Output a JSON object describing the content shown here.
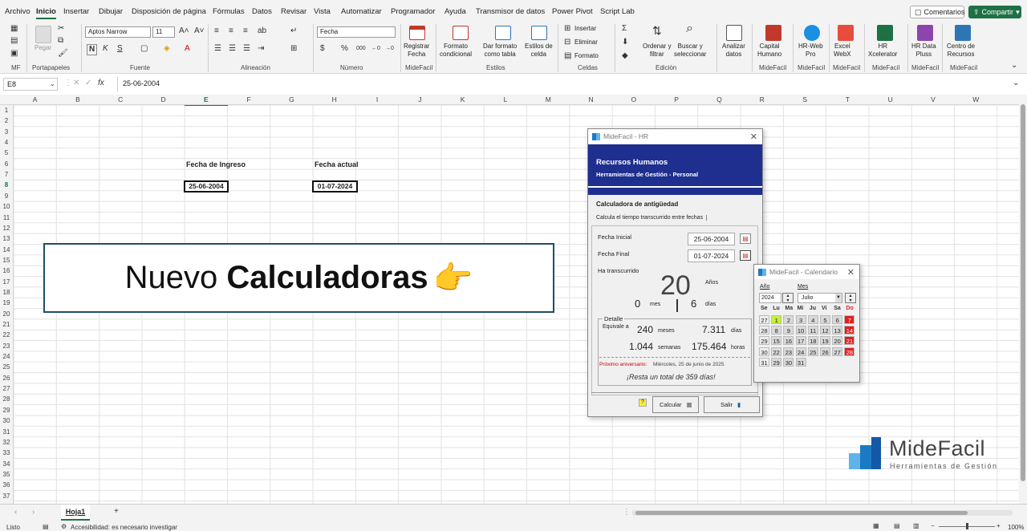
{
  "menu": {
    "tabs": [
      "Archivo",
      "Inicio",
      "Insertar",
      "Dibujar",
      "Disposición de página",
      "Fórmulas",
      "Datos",
      "Revisar",
      "Vista",
      "Automatizar",
      "Programador",
      "Ayuda",
      "Transmisor de datos",
      "Power Pivot",
      "Script Lab"
    ],
    "comments": "Comentarios",
    "share": "Compartir"
  },
  "ribbon": {
    "groups": {
      "mf": "MF",
      "portapapeles": "Portapapeles",
      "fuente": "Fuente",
      "alineacion": "Alineación",
      "numero": "Número",
      "midefacil1": "MideFacil",
      "estilos": "Estilos",
      "celdas": "Celdas",
      "edicion": "Edición",
      "midefacil2": "MideFacil",
      "midefacil3": "MideFacil",
      "midefacil4": "MideFacil",
      "midefacil5": "MideFacil",
      "midefacil6": "MideFacil",
      "midefacil7": "MideFacil"
    },
    "paste": "Pegar",
    "font_name": "Aptos Narrow",
    "font_size": "11",
    "number_format": "Fecha",
    "registrar": "Registrar\nFecha",
    "formato_cond": "Formato\ncondicional",
    "dar_formato": "Dar formato\ncomo tabla",
    "estilos_celda": "Estilos de\ncelda",
    "insertar": "Insertar",
    "eliminar": "Eliminar",
    "formato": "Formato",
    "ordenar": "Ordenar y\nfiltrar",
    "buscar": "Buscar y\nseleccionar",
    "analizar": "Analizar\ndatos",
    "capital": "Capital\nHumano",
    "hrweb": "HR-Web\nPro",
    "excelwebx": "Excel\nWebX",
    "hrxcel": "HR\nXcelerator",
    "hrdata": "HR Data\nPluss",
    "centro": "Centro de\nRecursos"
  },
  "formula_bar": {
    "name_box": "E8",
    "formula": "25-06-2004"
  },
  "columns": [
    "A",
    "B",
    "C",
    "D",
    "E",
    "F",
    "G",
    "H",
    "I",
    "J",
    "K",
    "L",
    "M",
    "N",
    "O",
    "P",
    "Q",
    "R",
    "S",
    "T",
    "U",
    "V",
    "W"
  ],
  "rows": [
    "1",
    "2",
    "3",
    "4",
    "5",
    "6",
    "7",
    "8",
    "9",
    "10",
    "11",
    "12",
    "13",
    "14",
    "15",
    "16",
    "17",
    "18",
    "19",
    "20",
    "21",
    "22",
    "23",
    "24",
    "25",
    "26",
    "27",
    "28",
    "29",
    "30",
    "31",
    "32",
    "33",
    "34",
    "35",
    "36",
    "37"
  ],
  "cells": {
    "label_ingreso": "Fecha de Ingreso",
    "label_actual": "Fecha actual",
    "ingreso": "25-06-2004",
    "actual": "01-07-2024"
  },
  "banner": {
    "normal": "Nuevo ",
    "bold": "Calculadoras",
    "emoji": "👉"
  },
  "hr_window": {
    "title": "MideFacil - HR",
    "header_title": "Recursos Humanos",
    "header_sub": "Herramientas de Gestión - Personal",
    "section": "Calculadora de antigüedad",
    "tab": "Calcula el tiempo transcurrido entre fechas",
    "start_label": "Fecha Inicial",
    "start_value": "25-06-2004",
    "end_label": "Fecha Final",
    "end_value": "01-07-2024",
    "elapsed_label": "Ha transcurrido",
    "years": "20",
    "years_unit": "Años",
    "months": "0",
    "months_unit": "mes",
    "days": "6",
    "days_unit": "días",
    "detail_label": "Detalle",
    "equiv": "Equivale a",
    "d_meses": "240",
    "d_meses_u": "meses",
    "d_dias": "7.311",
    "d_dias_u": "días",
    "d_semanas": "1.044",
    "d_semanas_u": "semanas",
    "d_horas": "175.464",
    "d_horas_u": "horas",
    "anniv_label": "Próximo aniversario:",
    "anniv_value": "Miércoles, 25 de junio de 2025",
    "remaining": "¡Resta un total de 359 días!",
    "calc_button": "Calcular",
    "exit_button": "Salir",
    "help": "?"
  },
  "cal_window": {
    "title": "MideFacil - Calendario",
    "year_label": "Año",
    "month_label": "Mes",
    "year": "2024",
    "month": "Julio",
    "days_header": [
      "Se",
      "Lu",
      "Ma",
      "Mi",
      "Ju",
      "Vi",
      "Sa",
      "Do"
    ],
    "weeks": [
      [
        "27",
        "1",
        "2",
        "3",
        "4",
        "5",
        "6",
        "7"
      ],
      [
        "28",
        "8",
        "9",
        "10",
        "11",
        "12",
        "13",
        "14"
      ],
      [
        "29",
        "15",
        "16",
        "17",
        "18",
        "19",
        "20",
        "21"
      ],
      [
        "30",
        "22",
        "23",
        "24",
        "25",
        "26",
        "27",
        "28"
      ],
      [
        "31",
        "29",
        "30",
        "31",
        "",
        "",
        "",
        ""
      ]
    ],
    "today": "1",
    "colors": {
      "sunday": "#e02020",
      "today": "#c6ef3a"
    }
  },
  "logo": {
    "name": "MideFacil",
    "tagline": "Herramientas de Gestión"
  },
  "sheets": {
    "active": "Hoja1",
    "add": "+"
  },
  "status": {
    "ready": "Listo",
    "accessibility": "Accesibilidad: es necesario investigar",
    "zoom": "100%"
  }
}
